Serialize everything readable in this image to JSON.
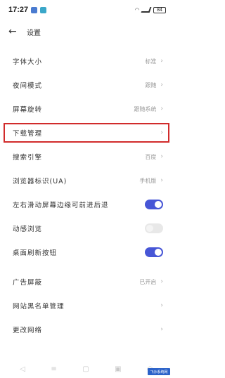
{
  "status": {
    "time": "17:27",
    "battery": "84"
  },
  "header": {
    "title": "设置"
  },
  "rows": [
    {
      "label": "字体大小",
      "value": "标准"
    },
    {
      "label": "夜间模式",
      "value": "跟随"
    },
    {
      "label": "屏幕旋转",
      "value": "跟随系统"
    },
    {
      "label": "下载管理",
      "value": ""
    },
    {
      "label": "搜索引擎",
      "value": "百度"
    },
    {
      "label": "浏览器标识(UA)",
      "value": "手机版"
    },
    {
      "label": "左右滑动屏幕边缘可前进后退",
      "value": ""
    },
    {
      "label": "动感浏览",
      "value": ""
    },
    {
      "label": "桌面刷新按钮",
      "value": ""
    },
    {
      "label": "广告屏蔽",
      "value": "已开启"
    },
    {
      "label": "网站黑名单管理",
      "value": ""
    },
    {
      "label": "更改网络",
      "value": ""
    }
  ],
  "toggles": {
    "swipe": true,
    "dynamic": false,
    "refresh": true
  },
  "icons": {
    "back": "arrow-left-icon",
    "chevron": "chevron-right-icon"
  },
  "colors": {
    "accent": "#4756d6",
    "highlight": "#d12b2b"
  },
  "watermark": "飞沙系统网"
}
